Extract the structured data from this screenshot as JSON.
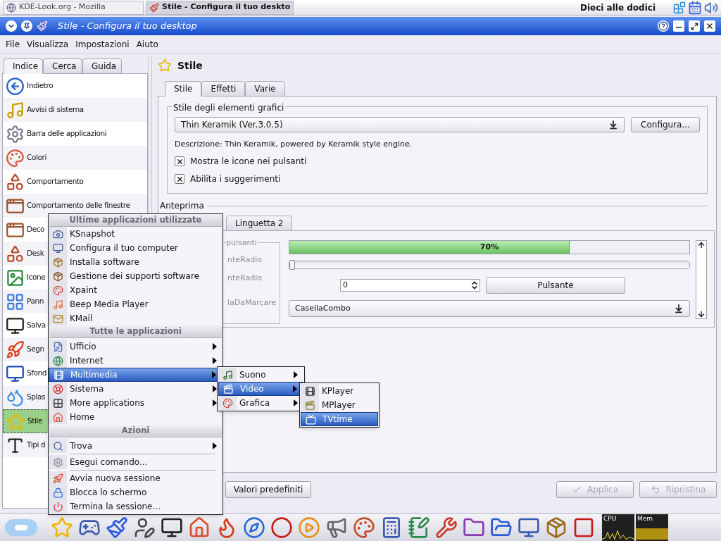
{
  "top_panel": {
    "tasks": [
      {
        "label": "KDE-Look.org - Mozilla",
        "selected": false
      },
      {
        "label": "Stile - Configura il tuo deskto",
        "selected": true
      }
    ],
    "clock": "Dieci alle dodici"
  },
  "window": {
    "title": "Stile - Configura il tuo desktop",
    "menu": [
      "File",
      "Visualizza",
      "Impostazioni",
      "Aiuto"
    ]
  },
  "sidebar": {
    "tabs": [
      {
        "label": "Indice",
        "selected": true
      },
      {
        "label": "Cerca",
        "selected": false
      },
      {
        "label": "Guida",
        "selected": false
      }
    ],
    "items": [
      {
        "label": "Indietro",
        "selected": false
      },
      {
        "label": "Avvisi di sistema",
        "selected": false
      },
      {
        "label": "Barra delle applicazioni",
        "selected": false
      },
      {
        "label": "Colori",
        "selected": false
      },
      {
        "label": "Comportamento",
        "selected": false
      },
      {
        "label": "Comportamento delle finestre",
        "selected": false
      },
      {
        "label": "Deco",
        "selected": false
      },
      {
        "label": "Desk",
        "selected": false
      },
      {
        "label": "Icone",
        "selected": false
      },
      {
        "label": "Pann",
        "selected": false
      },
      {
        "label": "Salva",
        "selected": false
      },
      {
        "label": "Segn",
        "selected": false
      },
      {
        "label": "Sfond",
        "selected": false
      },
      {
        "label": "Splas",
        "selected": false
      },
      {
        "label": "Stile",
        "selected": true
      },
      {
        "label": "Tipi d",
        "selected": false
      }
    ]
  },
  "content": {
    "title": "Stile",
    "tabs": [
      {
        "label": "Stile",
        "selected": true
      },
      {
        "label": "Effetti",
        "selected": false
      },
      {
        "label": "Varie",
        "selected": false
      }
    ],
    "style_group": {
      "title": "Stile degli elementi grafici",
      "combo": "Thin Keramik (Ver.3.0.5)",
      "button": "Configura...",
      "description": "Descrizione: Thin Keramik, powered by Keramik style engine.",
      "checkboxes": [
        {
          "label": "Mostra le icone nei pulsanti",
          "checked": true
        },
        {
          "label": "Abilita i suggerimenti",
          "checked": true
        }
      ]
    },
    "preview": {
      "title": "Anteprima",
      "tabs": [
        {
          "label": "Linguetta 2",
          "selected": false
        }
      ],
      "group": {
        "title": "pulsanti",
        "items": [
          "nteRadio",
          "nteRadio",
          "laDaMarcare"
        ]
      },
      "progress": {
        "label": "70%",
        "level": 0.7
      },
      "slider": {
        "level": 0
      },
      "spinbox": "0",
      "button": "Pulsante",
      "combo": "CasellaCombo"
    },
    "buttons": [
      {
        "label": "Valori predefiniti",
        "disabled": false
      },
      {
        "label": "Applica",
        "disabled": true
      },
      {
        "label": "Ripristina",
        "disabled": true
      }
    ]
  },
  "kmenu": {
    "sections": [
      {
        "title": "Ultime applicazioni utilizzate",
        "items": [
          {
            "kind": "entry",
            "label": "KSnapshot",
            "submenu": false,
            "selected": false
          },
          {
            "kind": "entry",
            "label": "Configura il tuo computer",
            "submenu": false,
            "selected": false
          },
          {
            "kind": "entry",
            "label": "Installa software",
            "submenu": false,
            "selected": false
          },
          {
            "kind": "entry",
            "label": "Gestione dei supporti software",
            "submenu": false,
            "selected": false
          },
          {
            "kind": "entry",
            "label": "Xpaint",
            "submenu": false,
            "selected": false
          },
          {
            "kind": "entry",
            "label": "Beep Media Player",
            "submenu": false,
            "selected": false
          },
          {
            "kind": "entry",
            "label": "KMail",
            "submenu": false,
            "selected": false
          }
        ]
      },
      {
        "title": "Tutte le applicazioni",
        "items": [
          {
            "kind": "entry",
            "label": "Ufficio",
            "submenu": true,
            "selected": false
          },
          {
            "kind": "entry",
            "label": "Internet",
            "submenu": true,
            "selected": false
          },
          {
            "kind": "entry",
            "label": "Multimedia",
            "submenu": true,
            "selected": true
          },
          {
            "kind": "entry",
            "label": "Sistema",
            "submenu": true,
            "selected": false
          },
          {
            "kind": "entry",
            "label": "More applications",
            "submenu": true,
            "selected": false
          },
          {
            "kind": "entry",
            "label": "Home",
            "submenu": false,
            "selected": false
          }
        ]
      },
      {
        "title": "Azioni",
        "items": [
          {
            "kind": "entry",
            "label": "Trova",
            "submenu": true,
            "selected": false
          },
          {
            "kind": "separator"
          },
          {
            "kind": "entry",
            "label": "Esegui comando...",
            "submenu": false,
            "selected": false
          },
          {
            "kind": "separator"
          },
          {
            "kind": "entry",
            "label": "Avvia nuova sessione",
            "submenu": false,
            "selected": false
          },
          {
            "kind": "entry",
            "label": "Blocca lo schermo",
            "submenu": false,
            "selected": false
          },
          {
            "kind": "entry",
            "label": "Termina la sessione...",
            "submenu": false,
            "selected": false
          }
        ]
      }
    ]
  },
  "submenus": [
    {
      "items": [
        {
          "label": "Suono",
          "submenu": true,
          "selected": false
        },
        {
          "label": "Video",
          "submenu": true,
          "selected": true
        },
        {
          "label": "Grafica",
          "submenu": true,
          "selected": false
        }
      ]
    },
    {
      "items": [
        {
          "label": "KPlayer",
          "submenu": false,
          "selected": false
        },
        {
          "label": "MPlayer",
          "submenu": false,
          "selected": false
        },
        {
          "label": "TVtime",
          "submenu": false,
          "selected": true
        }
      ]
    }
  ],
  "panel": {
    "monitors": [
      "CPU",
      "Mem"
    ]
  }
}
